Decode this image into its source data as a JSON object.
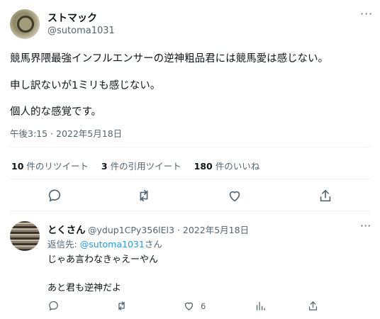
{
  "tweet": {
    "author_name": "ストマック",
    "author_handle": "@sutoma1031",
    "more_label": "···",
    "lines": [
      "競馬界隈最強インフルエンサーの逆神粗品君には競馬愛は感じない。",
      "申し訳ないが1ミリも感じない。",
      "個人的な感覚です。"
    ],
    "timestamp": "午後3:15 · 2022年5月18日",
    "stats": [
      {
        "count": "10",
        "label": "件のリツイート"
      },
      {
        "count": "3",
        "label": "件の引用ツイート"
      },
      {
        "count": "180",
        "label": "件のいいね"
      }
    ],
    "actions": [
      "reply-icon",
      "retweet-icon",
      "like-icon",
      "share-icon"
    ]
  },
  "reply": {
    "author_name": "とくさん",
    "meta": "@ydup1CPy356lEl3 · 2022年5月18日",
    "more_label": "···",
    "replying_to_prefix": "返信先: ",
    "replying_to_mention": "@sutoma1031",
    "replying_to_suffix": "さん",
    "lines": [
      "じゃあ言わなきゃえーやん",
      "あと君も逆神だよ"
    ],
    "like_count": "6",
    "actions": [
      "reply-icon",
      "retweet-icon",
      "like-icon",
      "analytics-icon",
      "share-icon"
    ]
  }
}
